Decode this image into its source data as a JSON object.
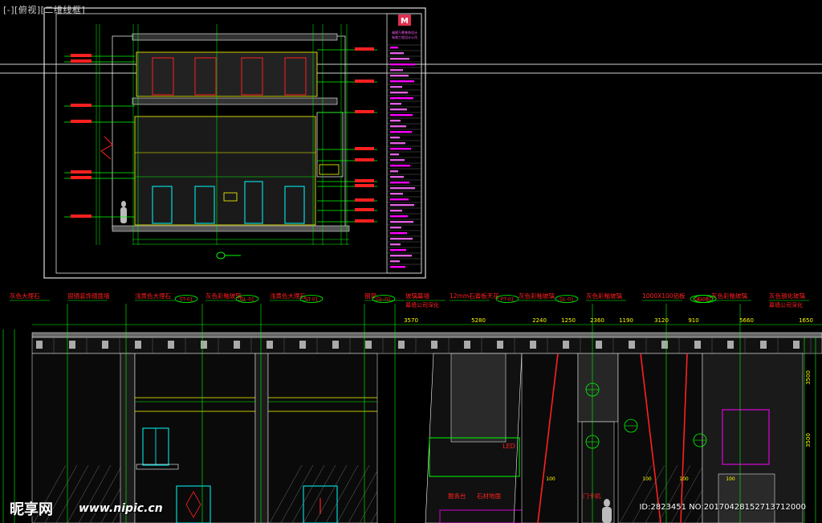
{
  "viewport": {
    "label": "[-][俯视][二维线框]"
  },
  "title_block": {
    "company_line1": "福建万景装饰设计",
    "company_line2": "有限工程设计公司"
  },
  "colors": {
    "background": "#000000",
    "green": "#00ff00",
    "red": "#ff2020",
    "magenta": "#ff00ff",
    "cyan": "#00ffff",
    "yellow": "#ffff00",
    "white": "#ffffff",
    "gray": "#9a9a9a"
  },
  "elevation": {
    "callouts": [
      "灰色大理石",
      "银镜装饰镜面墙",
      "浅黄色大理石",
      "灰色彩釉玻璃",
      "浅黄色大理石",
      "钢架",
      "玻璃幕墙",
      "12mm石膏板天花",
      "灰色彩釉玻璃",
      "灰色彩釉玻璃",
      "1000X100铝板",
      "灰色彩釉玻璃",
      "灰色钢化玻璃"
    ],
    "material_tags": [
      "ST-01",
      "GL-01",
      "ST-01",
      "GL-01",
      "PT-01",
      "GL-01",
      "GL-01",
      "GL-01"
    ],
    "dimensions": [
      "3570",
      "5280",
      "2240",
      "1250",
      "2360",
      "1190",
      "3120",
      "910",
      "5660",
      "1650"
    ],
    "side_dimensions": [
      "3500",
      "3500"
    ],
    "sub_labels": [
      "幕墙公司深化",
      "幕墙公司深化"
    ],
    "bottom_labels": [
      "服务台",
      "石材地面",
      "门卡机"
    ],
    "led_label": "LED",
    "small_numbers": [
      "100",
      "100",
      "100",
      "100"
    ]
  },
  "watermark": {
    "logo": "昵享网",
    "url": "www.nipic.cn",
    "id": "ID:2823451 NO:20170428152713712000"
  }
}
